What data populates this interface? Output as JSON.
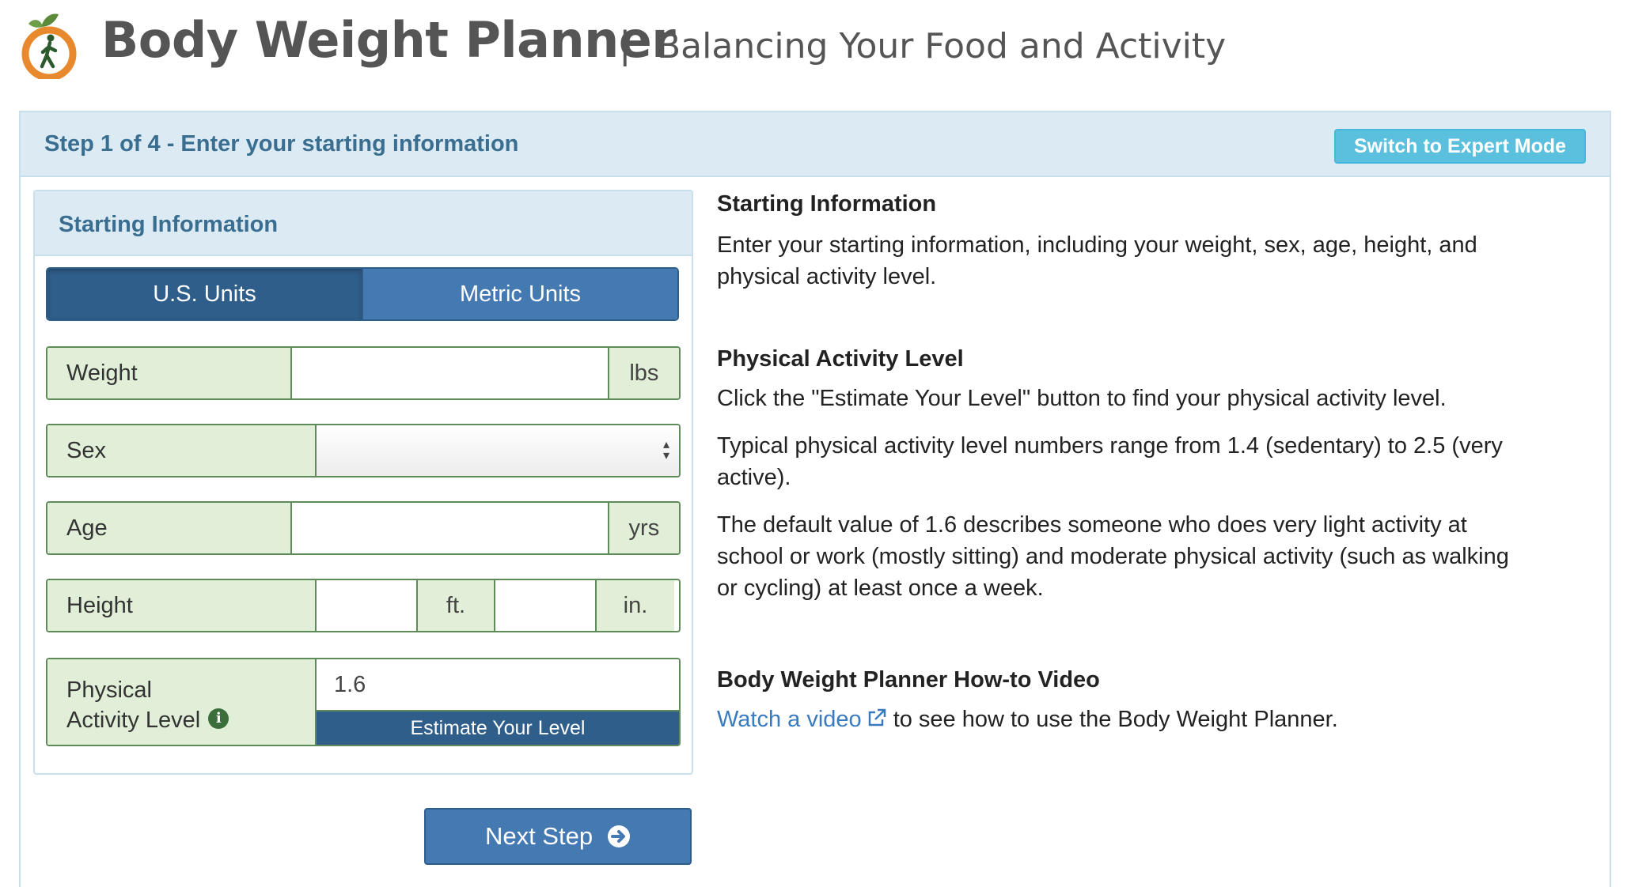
{
  "header": {
    "title": "Body Weight Planner",
    "divider": "|",
    "subtitle": "Balancing Your Food and Activity",
    "logo_icon": "walking-person-apple-logo"
  },
  "step": {
    "title": "Step 1 of 4 - Enter your starting information",
    "expert_mode_label": "Switch to Expert Mode"
  },
  "form": {
    "heading": "Starting Information",
    "units": {
      "us_label": "U.S. Units",
      "metric_label": "Metric Units",
      "selected": "U.S. Units"
    },
    "weight": {
      "label": "Weight",
      "value": "",
      "unit": "lbs"
    },
    "sex": {
      "label": "Sex",
      "selected": ""
    },
    "age": {
      "label": "Age",
      "value": "",
      "unit": "yrs"
    },
    "height": {
      "label": "Height",
      "feet_value": "",
      "feet_unit": "ft.",
      "inches_value": "",
      "inches_unit": "in."
    },
    "activity": {
      "label_line1": "Physical",
      "label_line2": "Activity Level",
      "value": "1.6",
      "estimate_label": "Estimate Your Level"
    },
    "next_label": "Next Step"
  },
  "info": {
    "starting_heading": "Starting Information",
    "starting_text": "Enter your starting information, including your weight, sex, age, height, and physical activity level.",
    "pal_heading": "Physical Activity Level",
    "pal_text1": "Click the \"Estimate Your Level\" button to find your physical activity level.",
    "pal_text2": "Typical physical activity level numbers range from 1.4 (sedentary) to 2.5 (very active).",
    "pal_text3": "The default value of 1.6 describes someone who does very light activity at school or work (mostly sitting) and moderate physical activity (such as walking or cycling) at least once a week.",
    "video_heading": "Body Weight Planner How-to Video",
    "video_link": "Watch a video",
    "video_text": "to see how to use the Body Weight Planner."
  },
  "colors": {
    "panel_heading_bg": "#dbeaf3",
    "heading_text": "#3a6e91",
    "primary_button": "#4579b2",
    "active_unit": "#2f5e8a",
    "field_label_bg": "#e1efd8",
    "field_border": "#5f8a5a",
    "info_button": "#5bc0de",
    "link": "#3a7bbf"
  }
}
